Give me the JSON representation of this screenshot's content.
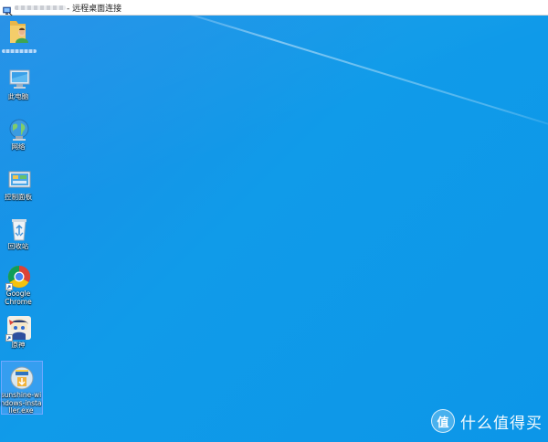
{
  "window": {
    "title": "- 远程桌面连接"
  },
  "desktop": {
    "icons": [
      {
        "label": ""
      },
      {
        "label": "此电脑"
      },
      {
        "label": "网络"
      },
      {
        "label": "控制面板"
      },
      {
        "label": "回收站"
      },
      {
        "label": "Google\nChrome"
      },
      {
        "label": "原神"
      },
      {
        "label": "sunshine-wi\nndows-insta\nller.exe"
      }
    ]
  },
  "watermark": {
    "badge": "值",
    "text": "什么值得买"
  },
  "colors": {
    "desktop_blue": "#109be9",
    "selection": "#6fa7ff"
  }
}
